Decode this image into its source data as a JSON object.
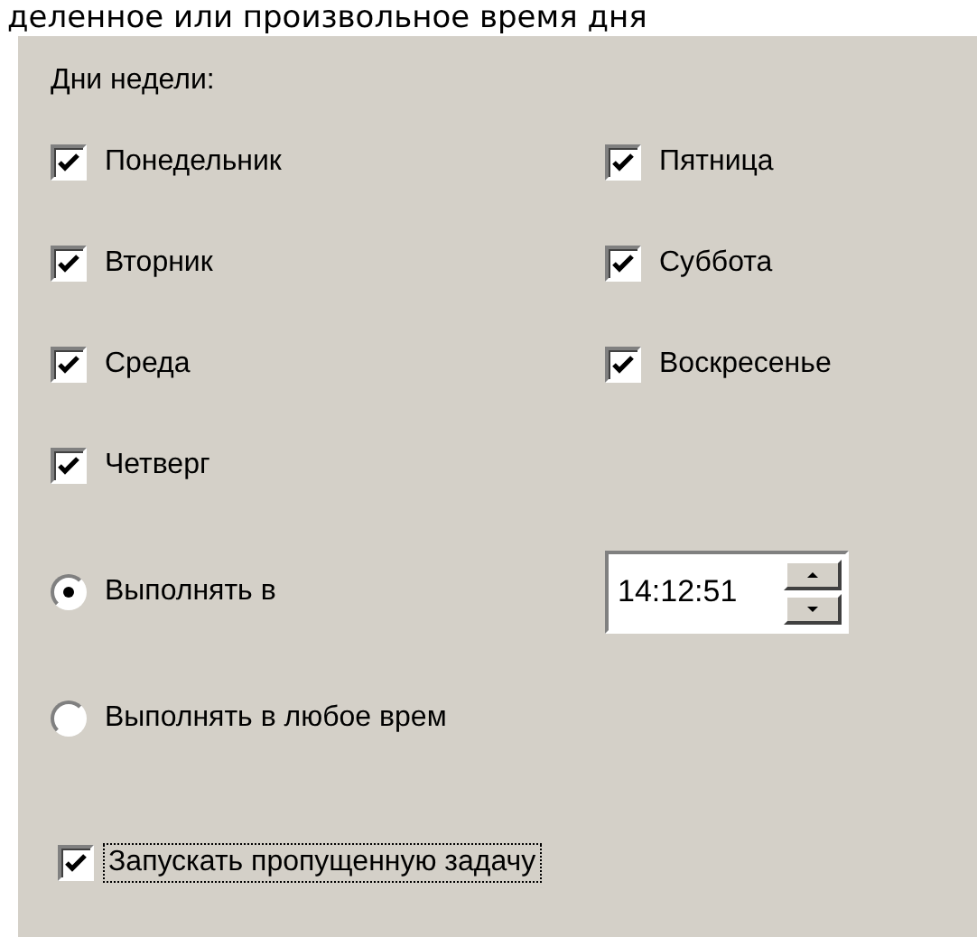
{
  "heading": "деленное или произвольное время дня",
  "days_label": "Дни недели:",
  "days": [
    {
      "label": "Понедельник",
      "checked": true
    },
    {
      "label": "Вторник",
      "checked": true
    },
    {
      "label": "Среда",
      "checked": true
    },
    {
      "label": "Четверг",
      "checked": true
    },
    {
      "label": "Пятница",
      "checked": true
    },
    {
      "label": "Суббота",
      "checked": true
    },
    {
      "label": "Воскресенье",
      "checked": true
    }
  ],
  "run_mode": [
    {
      "label": "Выполнять в",
      "selected": true,
      "kind": "time"
    },
    {
      "label": "Выполнять в любое врем",
      "selected": false,
      "kind": "plain"
    }
  ],
  "time_value": "14:12:51",
  "run_missed": {
    "label": "Запускать пропущенную задачу",
    "checked": true,
    "focused": true
  }
}
